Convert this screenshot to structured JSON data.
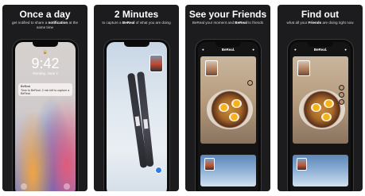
{
  "cards": [
    {
      "title": "Once a day",
      "subtitle_pre": "get notified to share a",
      "subtitle_bold": "notification",
      "subtitle_post": "at the same time",
      "lock_time": "9:42",
      "lock_date": "Monday, June 7",
      "notification": {
        "app": "BeReal",
        "message": "Time to BeReal. 2 min left to capture a BeReal."
      }
    },
    {
      "title": "2 Minutes",
      "subtitle_pre": "to capture a",
      "subtitle_bold": "BeReal",
      "subtitle_post": "of what you are doing"
    },
    {
      "title": "See your Friends",
      "subtitle_pre": "BeReal your moment and",
      "subtitle_bold": "BeReal",
      "subtitle_post": "to friends",
      "header": "BeReal."
    },
    {
      "title": "Find out",
      "subtitle_pre": "what all your",
      "subtitle_bold": "Friends",
      "subtitle_post": "are doing right now",
      "header": "BeReal."
    }
  ],
  "colors": {
    "card_bg": "#1c1c1e",
    "accent_blue": "#2f7de1"
  }
}
